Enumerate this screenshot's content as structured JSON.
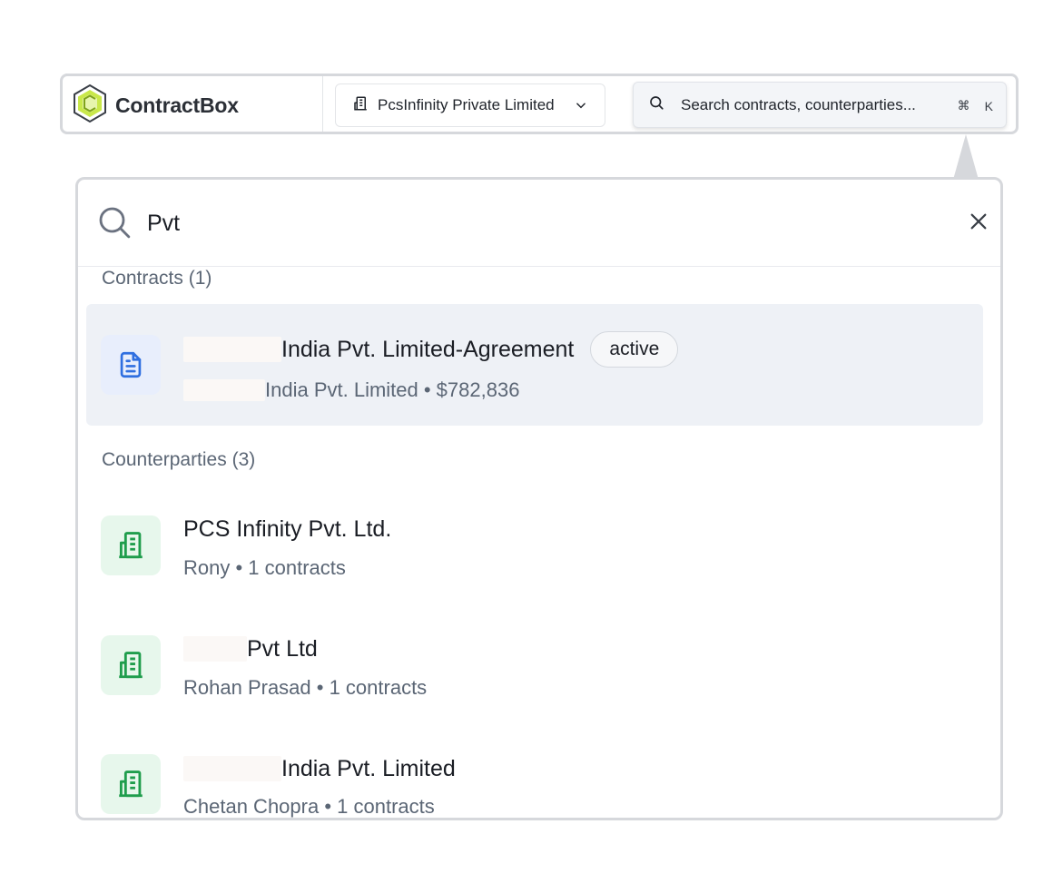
{
  "header": {
    "brand_name": "ContractBox",
    "org_selector": {
      "label": "PcsInfinity Private Limited"
    },
    "search": {
      "placeholder": "Search contracts, counterparties...",
      "shortcut_symbol": "⌘",
      "shortcut_key": "K"
    }
  },
  "palette": {
    "query": "Pvt",
    "contracts": {
      "heading": "Contracts (1)",
      "items": [
        {
          "title": "India Pvt. Limited-Agreement",
          "status": "active",
          "subtitle": "India Pvt. Limited • $782,836"
        }
      ]
    },
    "counterparties": {
      "heading": "Counterparties (3)",
      "items": [
        {
          "title": "PCS Infinity Pvt. Ltd.",
          "subtitle": "Rony • 1 contracts"
        },
        {
          "title": "Pvt Ltd",
          "subtitle": "Rohan Prasad • 1 contracts"
        },
        {
          "title": "India Pvt. Limited",
          "subtitle": "Chetan Chopra • 1 contracts"
        }
      ]
    }
  },
  "colors": {
    "accent_blue": "#2f6fe0",
    "accent_green": "#1f9d4c",
    "brand_lime": "#c9e84a"
  },
  "icons": [
    "logo-icon",
    "building-icon",
    "chevron-down-icon",
    "search-icon",
    "command-icon",
    "close-icon",
    "document-icon"
  ]
}
